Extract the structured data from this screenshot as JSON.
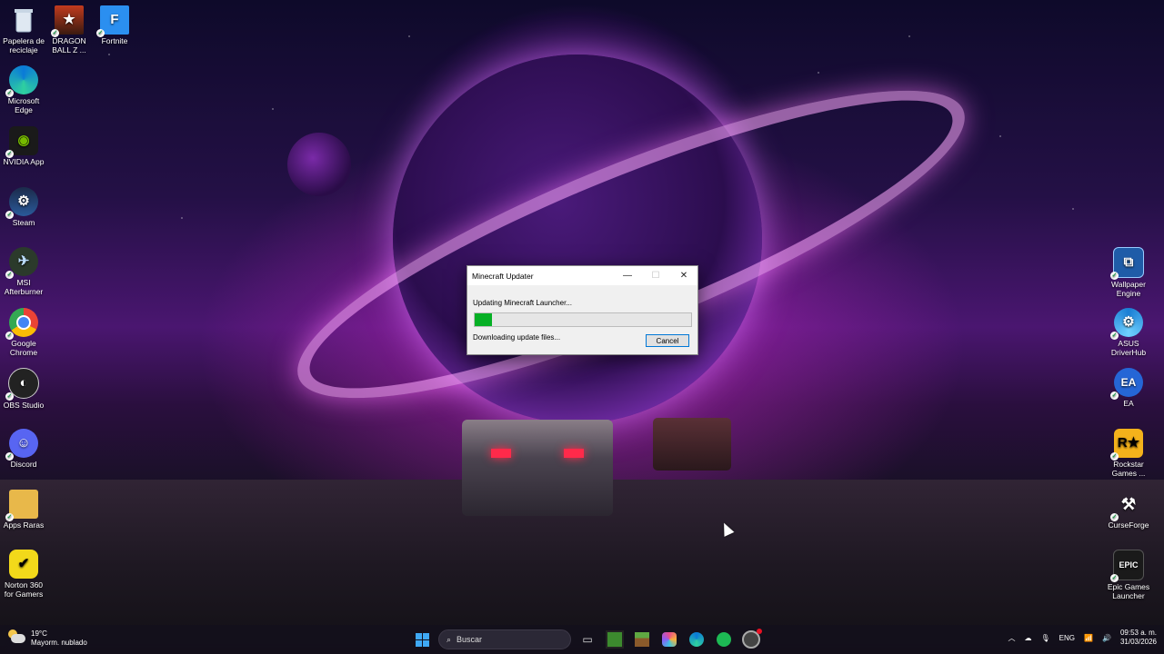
{
  "desktop": {
    "left_icons": [
      {
        "label": "Papelera de reciclaje",
        "icon": "recycle-bin-icon"
      },
      {
        "label": "Microsoft Edge",
        "icon": "edge-icon"
      },
      {
        "label": "NVIDIA App",
        "icon": "nvidia-icon"
      },
      {
        "label": "Steam",
        "icon": "steam-icon"
      },
      {
        "label": "MSI Afterburner",
        "icon": "msi-afterburner-icon"
      },
      {
        "label": "Google Chrome",
        "icon": "chrome-icon"
      },
      {
        "label": "OBS Studio",
        "icon": "obs-icon"
      },
      {
        "label": "Discord",
        "icon": "discord-icon"
      },
      {
        "label": "Apps Raras",
        "icon": "folder-icon"
      },
      {
        "label": "Norton 360 for Gamers",
        "icon": "norton-icon"
      }
    ],
    "top_icons": [
      {
        "label": "DRAGON BALL Z ...",
        "icon": "dragon-ball-icon"
      },
      {
        "label": "Fortnite",
        "icon": "fortnite-icon"
      }
    ],
    "right_icons": [
      {
        "label": "Wallpaper Engine",
        "icon": "wallpaper-engine-icon"
      },
      {
        "label": "ASUS DriverHub",
        "icon": "asus-driverhub-icon"
      },
      {
        "label": "EA",
        "icon": "ea-icon"
      },
      {
        "label": "Rockstar Games ...",
        "icon": "rockstar-icon"
      },
      {
        "label": "CurseForge",
        "icon": "curseforge-icon"
      },
      {
        "label": "Epic Games Launcher",
        "icon": "epic-games-icon"
      }
    ]
  },
  "dialog": {
    "title": "Minecraft Updater",
    "status_line1": "Updating Minecraft Launcher...",
    "status_line2": "Downloading update files...",
    "progress_fraction": 0.08,
    "progress_color": "#06b025",
    "cancel_label": "Cancel"
  },
  "taskbar": {
    "weather_temp": "19°C",
    "weather_desc": "Mayorm. nublado",
    "search_placeholder": "Buscar",
    "language": "ENG",
    "time": "09:53 a. m.",
    "date": "31/03/2026",
    "pinned": [
      "start-icon",
      "task-view-icon",
      "minecraft-icon",
      "minecraft-legacy-icon",
      "copilot-icon",
      "edge-icon",
      "spotify-icon",
      "chrome-like-icon"
    ]
  }
}
